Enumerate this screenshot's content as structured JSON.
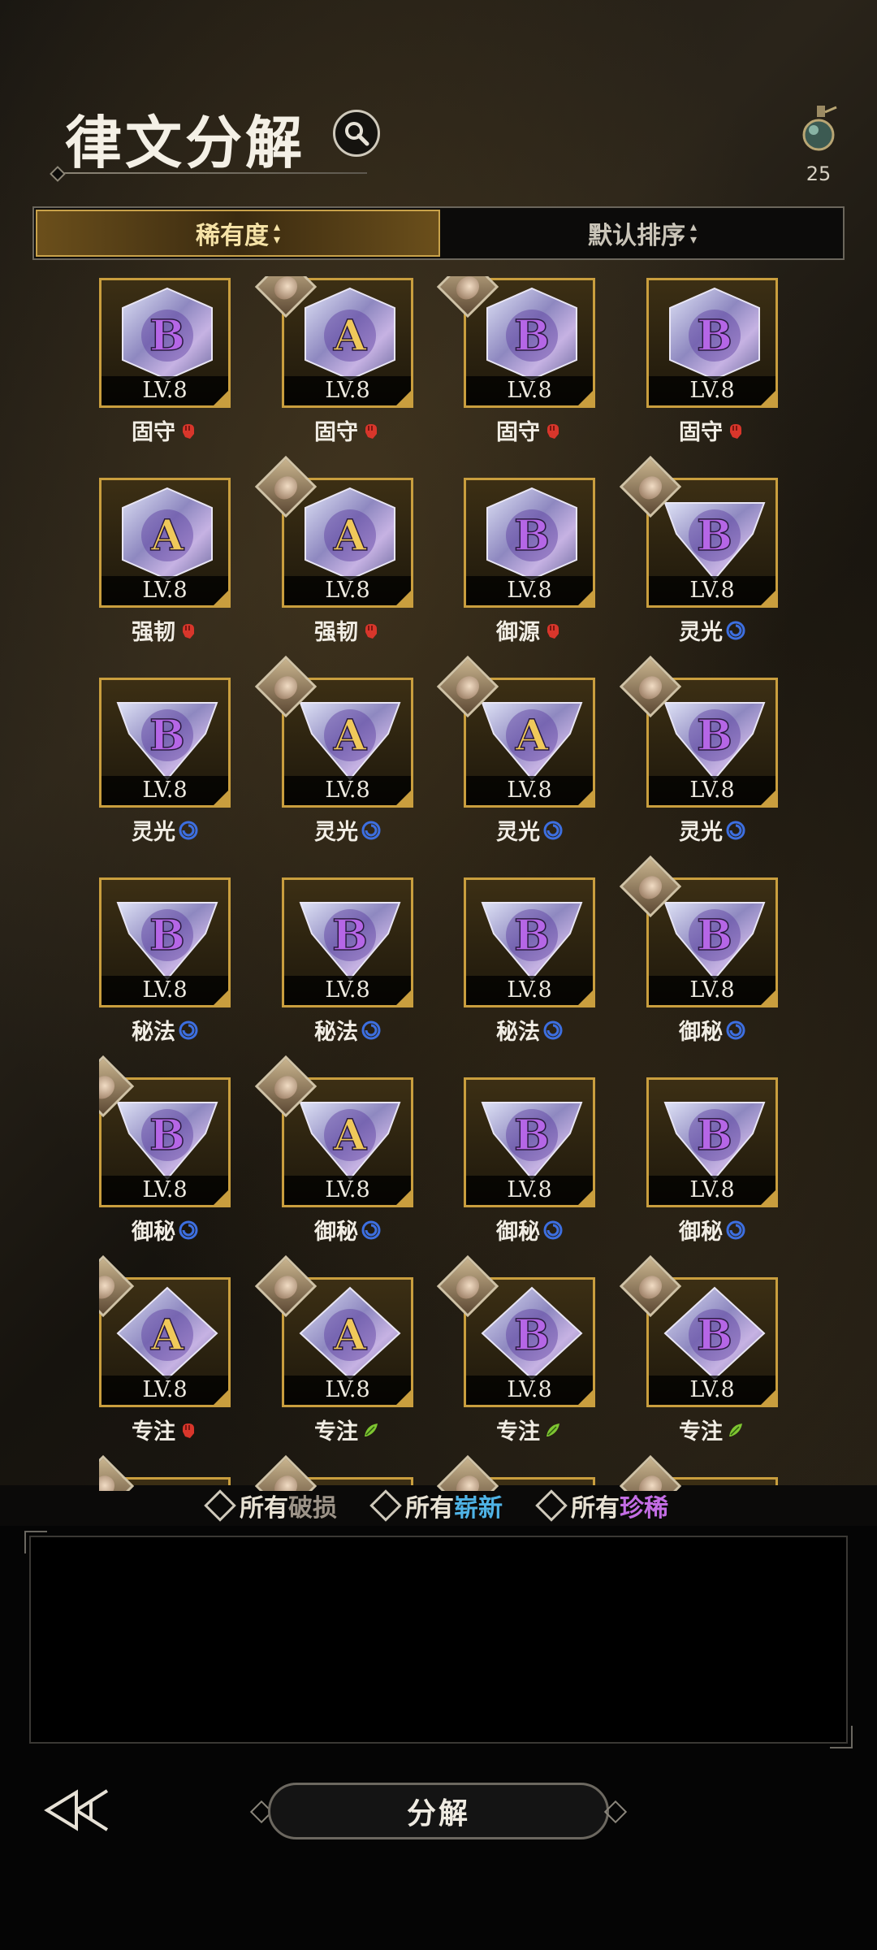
{
  "header": {
    "title": "律文分解",
    "currency_count": "25"
  },
  "sort": {
    "rarity_label": "稀有度",
    "default_label": "默认排序",
    "arrow": "▲▼"
  },
  "items": [
    {
      "grade": "B",
      "level": "LV.8",
      "name": "固守",
      "shape": "hex",
      "type": "red",
      "portrait": false
    },
    {
      "grade": "A",
      "level": "LV.8",
      "name": "固守",
      "shape": "hex",
      "type": "red",
      "portrait": true
    },
    {
      "grade": "B",
      "level": "LV.8",
      "name": "固守",
      "shape": "hex",
      "type": "red",
      "portrait": true
    },
    {
      "grade": "B",
      "level": "LV.8",
      "name": "固守",
      "shape": "hex",
      "type": "red",
      "portrait": false
    },
    {
      "grade": "A",
      "level": "LV.8",
      "name": "强韧",
      "shape": "hex",
      "type": "red",
      "portrait": false
    },
    {
      "grade": "A",
      "level": "LV.8",
      "name": "强韧",
      "shape": "hex",
      "type": "red",
      "portrait": true
    },
    {
      "grade": "B",
      "level": "LV.8",
      "name": "御源",
      "shape": "hex",
      "type": "red",
      "portrait": false
    },
    {
      "grade": "B",
      "level": "LV.8",
      "name": "灵光",
      "shape": "tri",
      "type": "blue",
      "portrait": true
    },
    {
      "grade": "B",
      "level": "LV.8",
      "name": "灵光",
      "shape": "tri",
      "type": "blue",
      "portrait": false
    },
    {
      "grade": "A",
      "level": "LV.8",
      "name": "灵光",
      "shape": "tri",
      "type": "blue",
      "portrait": true
    },
    {
      "grade": "A",
      "level": "LV.8",
      "name": "灵光",
      "shape": "tri",
      "type": "blue",
      "portrait": true
    },
    {
      "grade": "B",
      "level": "LV.8",
      "name": "灵光",
      "shape": "tri",
      "type": "blue",
      "portrait": true
    },
    {
      "grade": "B",
      "level": "LV.8",
      "name": "秘法",
      "shape": "tri",
      "type": "blue",
      "portrait": false
    },
    {
      "grade": "B",
      "level": "LV.8",
      "name": "秘法",
      "shape": "tri",
      "type": "blue",
      "portrait": false
    },
    {
      "grade": "B",
      "level": "LV.8",
      "name": "秘法",
      "shape": "tri",
      "type": "blue",
      "portrait": false
    },
    {
      "grade": "B",
      "level": "LV.8",
      "name": "御秘",
      "shape": "tri",
      "type": "blue",
      "portrait": true
    },
    {
      "grade": "B",
      "level": "LV.8",
      "name": "御秘",
      "shape": "tri",
      "type": "blue",
      "portrait": true
    },
    {
      "grade": "A",
      "level": "LV.8",
      "name": "御秘",
      "shape": "tri",
      "type": "blue",
      "portrait": true
    },
    {
      "grade": "B",
      "level": "LV.8",
      "name": "御秘",
      "shape": "tri",
      "type": "blue",
      "portrait": false
    },
    {
      "grade": "B",
      "level": "LV.8",
      "name": "御秘",
      "shape": "tri",
      "type": "blue",
      "portrait": false
    },
    {
      "grade": "A",
      "level": "LV.8",
      "name": "专注",
      "shape": "dia",
      "type": "red",
      "portrait": true
    },
    {
      "grade": "A",
      "level": "LV.8",
      "name": "专注",
      "shape": "dia",
      "type": "green",
      "portrait": true
    },
    {
      "grade": "B",
      "level": "LV.8",
      "name": "专注",
      "shape": "dia",
      "type": "green",
      "portrait": true
    },
    {
      "grade": "B",
      "level": "LV.8",
      "name": "专注",
      "shape": "dia",
      "type": "green",
      "portrait": true
    },
    {
      "grade": "",
      "level": "",
      "name": "",
      "shape": "dia",
      "type": "",
      "portrait": true
    },
    {
      "grade": "",
      "level": "",
      "name": "",
      "shape": "dia",
      "type": "",
      "portrait": true
    },
    {
      "grade": "",
      "level": "",
      "name": "",
      "shape": "dia",
      "type": "",
      "portrait": true
    },
    {
      "grade": "",
      "level": "",
      "name": "",
      "shape": "dia",
      "type": "",
      "portrait": true
    }
  ],
  "filters": {
    "prefix": "所有",
    "damaged": "破损",
    "new": "崭新",
    "rare": "珍稀"
  },
  "actions": {
    "decompose": "分解"
  },
  "colors": {
    "gold_border": "#c99e3e",
    "red_type": "#d8362b",
    "blue_type": "#3d6fe0",
    "green_type": "#7ec531",
    "new_filter": "#4fb3e6",
    "rare_filter": "#c36de4"
  }
}
